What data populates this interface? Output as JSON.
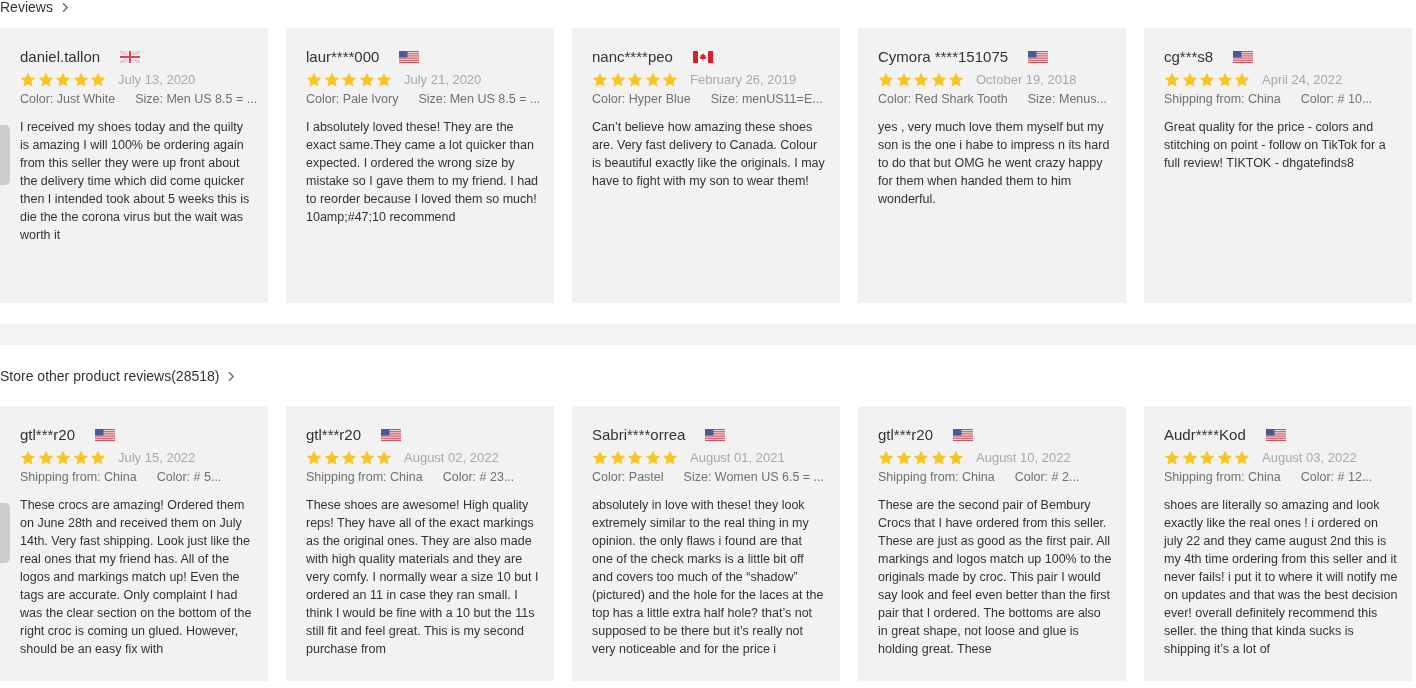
{
  "sections": [
    {
      "heading": "Reviews",
      "reviews": [
        {
          "name": "daniel.tallon",
          "flag": {
            "kind": "uk"
          },
          "stars": 5,
          "date": "July 13, 2020",
          "details": [
            "Color: Just White",
            "Size: Men US 8.5 = ..."
          ],
          "text": "I received my shoes today and the quilty is amazing I will 100% be ordering again from this seller they were up front about the delivery time which did come quicker then I intended took about 5 weeks this is die the the corona virus but the wait was worth it"
        },
        {
          "name": "laur****000",
          "flag": {
            "kind": "us"
          },
          "stars": 5,
          "date": "July 21, 2020",
          "details": [
            "Color: Pale Ivory",
            "Size: Men US 8.5 = ..."
          ],
          "text": "I absolutely loved these! They are the exact same.They came a lot quicker than expected. I ordered the wrong size by mistake so I gave them to my friend. I had to reorder because I loved them so much! 10amp;#47;10 recommend"
        },
        {
          "name": "nanc****peo",
          "flag": {
            "kind": "ca"
          },
          "stars": 5,
          "date": "February 26, 2019",
          "details": [
            "Color: Hyper Blue",
            "Size: menUS11=E..."
          ],
          "text": "Can’t believe how amazing these shoes are. Very fast delivery to Canada. Colour is beautiful exactly like the originals. I may have to fight with my son to wear them!"
        },
        {
          "name": "Cymora ****151075",
          "flag": {
            "kind": "us"
          },
          "stars": 5,
          "date": "October 19, 2018",
          "details": [
            "Color: Red Shark Tooth",
            "Size: Menus..."
          ],
          "text": "yes , very much love them myself but my son is the one i habe to impress n its hard to do that but OMG he went crazy happy for them when handed them to him wonderful."
        },
        {
          "name": "cg***s8",
          "flag": {
            "kind": "us"
          },
          "stars": 5,
          "date": "April 24, 2022",
          "details": [
            "Shipping from: China",
            "Color: # 10..."
          ],
          "text": "Great quality for the price - colors and stitching on point - follow on TikTok for a full review! TIKTOK - dhgatefinds8"
        }
      ]
    },
    {
      "heading": "Store other product reviews(28518)",
      "reviews": [
        {
          "name": "gtl***r20",
          "flag": {
            "kind": "us"
          },
          "stars": 5,
          "date": "July 15, 2022",
          "details": [
            "Shipping from: China",
            "Color: # 5..."
          ],
          "text": "These crocs are amazing! Ordered them on June 28th and received them on July 14th. Very fast shipping. Look just like the real ones that my friend has. All of the logos and markings match up! Even the tags are accurate. Only complaint I had was the clear section on the bottom of the right croc is coming un glued. However, should be an easy fix with"
        },
        {
          "name": "gtl***r20",
          "flag": {
            "kind": "us"
          },
          "stars": 5,
          "date": "August 02, 2022",
          "details": [
            "Shipping from: China",
            "Color: # 23..."
          ],
          "text": "These shoes are awesome! High quality reps! They have all of the exact markings as the original ones. They are also made with high quality materials and they are very comfy. I normally wear a size 10 but I ordered an 11 in case they ran small. I think I would be fine with a 10 but the 11s still fit and feel great. This is my second purchase from"
        },
        {
          "name": "Sabri****orrea",
          "flag": {
            "kind": "us"
          },
          "stars": 5,
          "date": "August 01, 2021",
          "details": [
            "Color: Pastel",
            "Size: Women US 6.5 = ..."
          ],
          "text": "absolutely in love with these! they look extremely similar to the real thing in my opinion. the only flaws i found are that one of the check marks is a little bit off and covers too much of the “shadow” (pictured) and the hole for the laces at the top has a little extra half hole? that’s not supposed to be there but it’s really not very noticeable and for the price i"
        },
        {
          "name": "gtl***r20",
          "flag": {
            "kind": "us"
          },
          "stars": 5,
          "date": "August 10, 2022",
          "details": [
            "Shipping from: China",
            "Color: # 2..."
          ],
          "text": "These are the second pair of Bembury Crocs that I have ordered from this seller. These are just as good as the first pair. All markings and logos match up 100% to the originals made by croc. This pair I would say look and feel even better than the first pair that I ordered. The bottoms are also in great shape, not loose and glue is holding great. These"
        },
        {
          "name": "Audr****Kod",
          "flag": {
            "kind": "us"
          },
          "stars": 5,
          "date": "August 03, 2022",
          "details": [
            "Shipping from: China",
            "Color: # 12..."
          ],
          "text": "shoes are literally so amazing and look exactly like the real ones ! i ordered on july 22 and they came august 2nd this is my 4th time ordering from this seller and it never fails! i put it to where it will notify me on updates and that was the best decision ever! overall definitely recommend this seller. the thing that kinda sucks is shipping it’s a lot of"
        }
      ]
    }
  ]
}
